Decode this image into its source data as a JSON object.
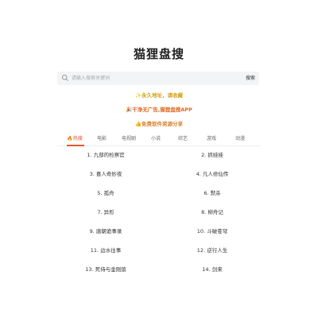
{
  "title": "猫狸盘搜",
  "search": {
    "placeholder": "请输入搜索关键词",
    "button": "搜索"
  },
  "promos": [
    "✨永久地址，请收藏",
    "🎉干净无广告,猫狸盘搜APP",
    "👍免费软件资源分享"
  ],
  "tabs": [
    "🔥热搜",
    "电影",
    "电视剧",
    "小说",
    "综艺",
    "游戏",
    "动漫"
  ],
  "active_tab": "🔥热搜",
  "ranking": [
    "1. 九部的检察官",
    "2. 抓娃娃",
    "3. 喜人奇妙夜",
    "4. 凡人修仙传",
    "5. 孤舟",
    "6. 默杀",
    "7. 异形",
    "8. 柳舟记",
    "9. 唐朝诡事录",
    "10. 斗破苍穹",
    "11. 边水往事",
    "12. 逆行人生",
    "13. 死侍与金刚狼",
    "14. 剑来"
  ],
  "colors": {
    "accent": "#e4572e",
    "promo1": "#d4a017",
    "promo2": "#e0661f",
    "promo3": "#d9822b"
  }
}
